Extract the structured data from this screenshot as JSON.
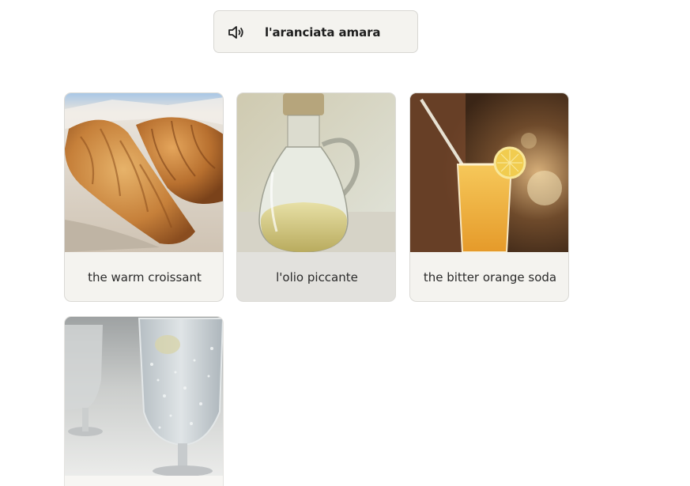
{
  "prompt": {
    "icon": "speaker-icon",
    "text": "l'aranciata amara"
  },
  "cards": [
    {
      "label": "the warm croissant",
      "image": "croissant-photo"
    },
    {
      "label": "l'olio piccante",
      "image": "oil-jug-photo",
      "selected": true
    },
    {
      "label": "the bitter orange soda",
      "image": "orange-soda-photo"
    },
    {
      "label": "",
      "image": "sparkling-water-photo"
    }
  ]
}
